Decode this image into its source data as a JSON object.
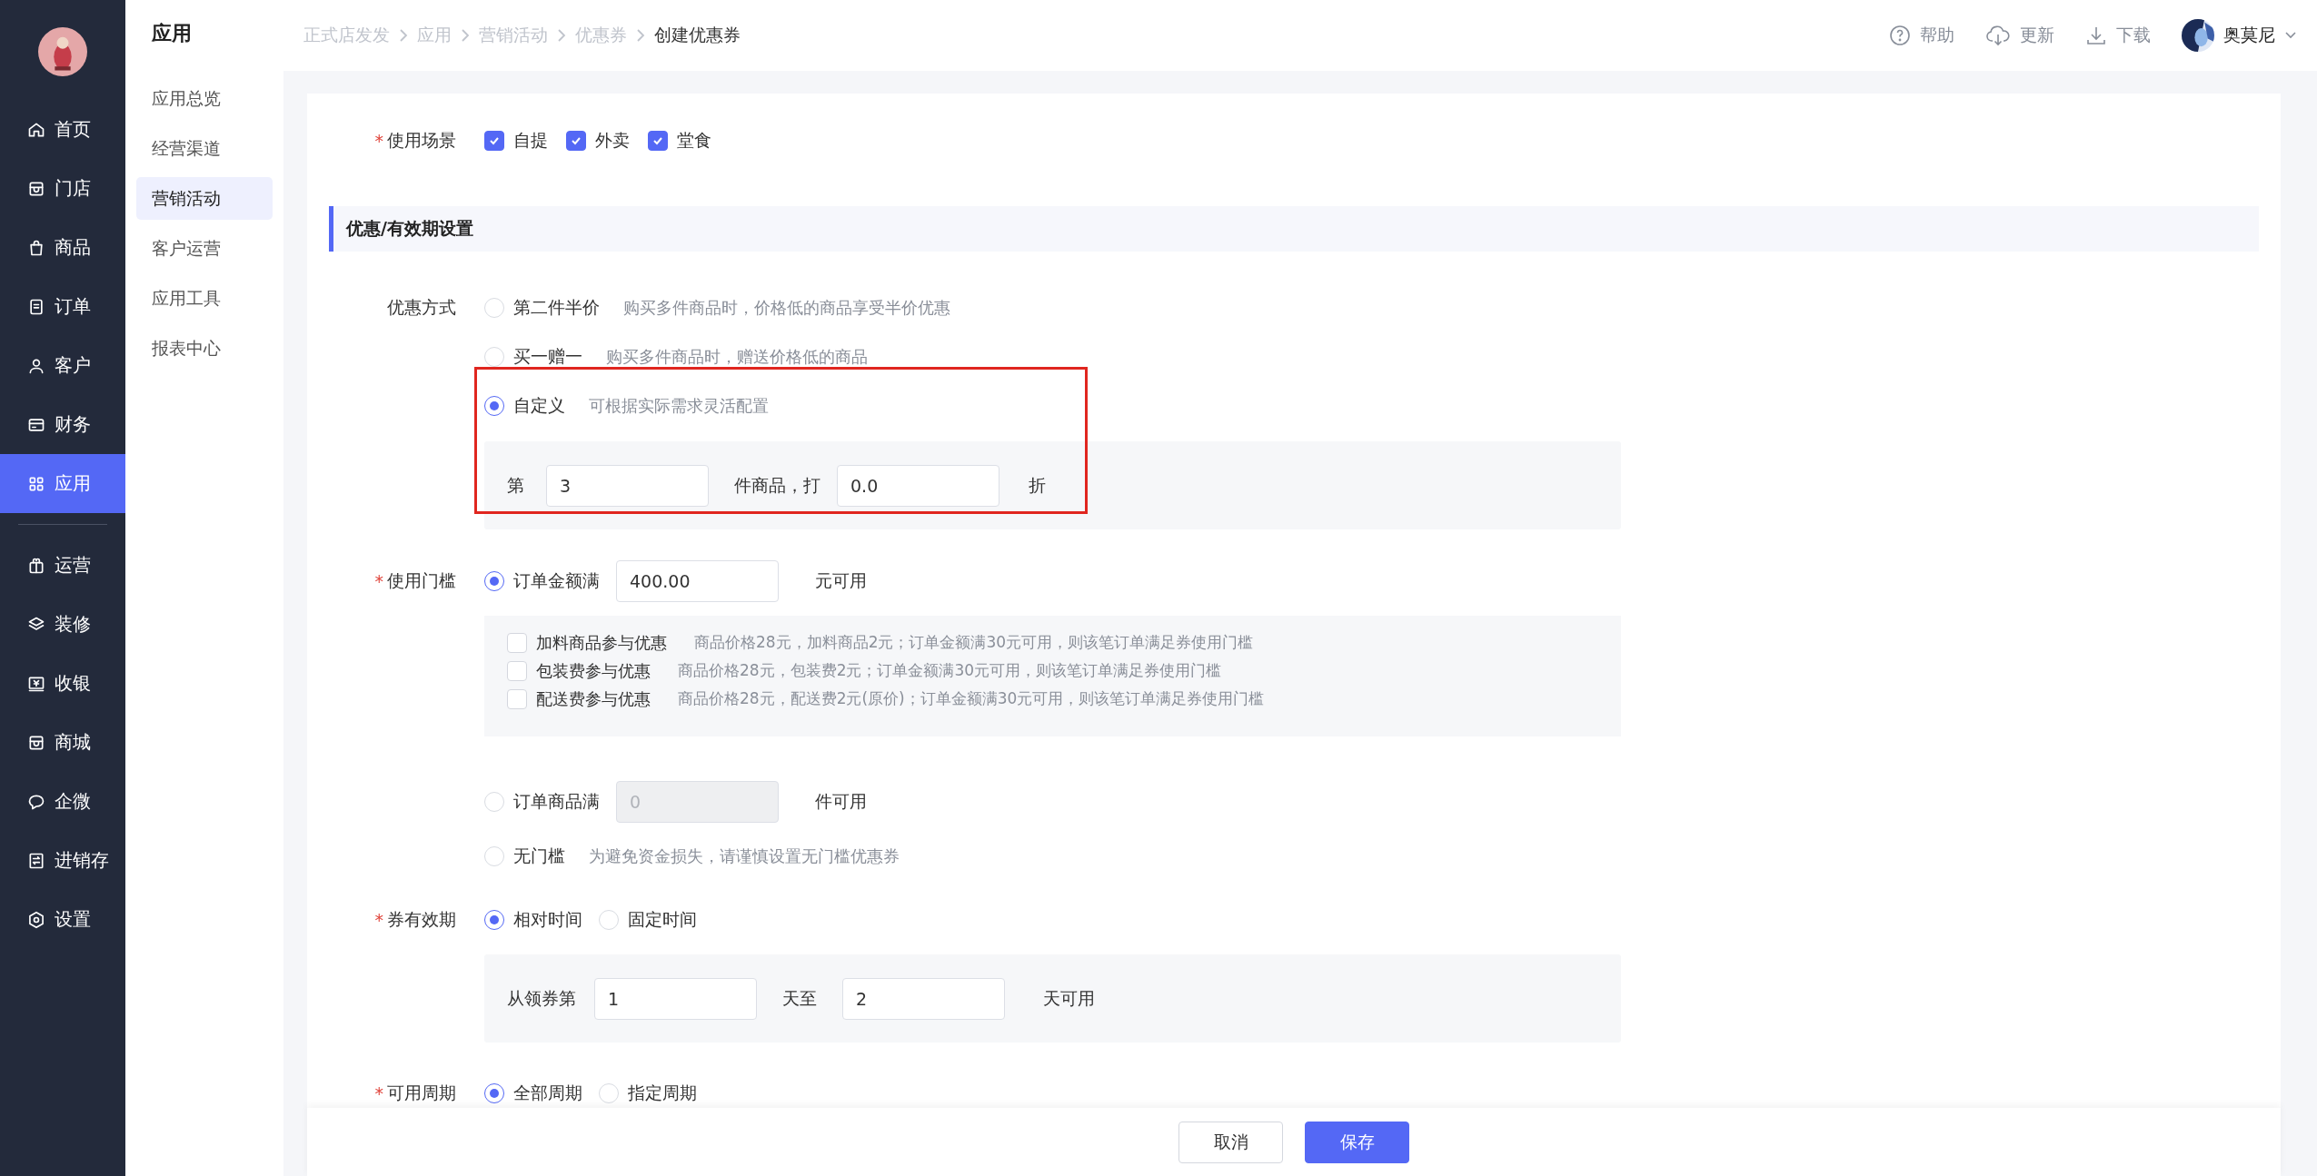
{
  "nav": {
    "primary": [
      {
        "label": "首页",
        "selected": false
      },
      {
        "label": "门店",
        "selected": false
      },
      {
        "label": "商品",
        "selected": false
      },
      {
        "label": "订单",
        "selected": false
      },
      {
        "label": "客户",
        "selected": false
      },
      {
        "label": "财务",
        "selected": false
      },
      {
        "label": "应用",
        "selected": true
      }
    ],
    "secondary": [
      {
        "label": "运营",
        "selected": false
      },
      {
        "label": "装修",
        "selected": false
      },
      {
        "label": "收银",
        "selected": false
      },
      {
        "label": "商城",
        "selected": false
      },
      {
        "label": "企微",
        "selected": false
      },
      {
        "label": "进销存",
        "selected": false
      },
      {
        "label": "设置",
        "selected": false
      }
    ]
  },
  "submenu": {
    "title": "应用",
    "items": [
      {
        "label": "应用总览",
        "selected": false
      },
      {
        "label": "经营渠道",
        "selected": false
      },
      {
        "label": "营销活动",
        "selected": true
      },
      {
        "label": "客户运营",
        "selected": false
      },
      {
        "label": "应用工具",
        "selected": false
      },
      {
        "label": "报表中心",
        "selected": false
      }
    ]
  },
  "breadcrumb": [
    {
      "label": "正式店发发",
      "current": false
    },
    {
      "label": "应用",
      "current": false
    },
    {
      "label": "营销活动",
      "current": false
    },
    {
      "label": "优惠券",
      "current": false
    },
    {
      "label": "创建优惠券",
      "current": true
    }
  ],
  "header_actions": [
    {
      "label": "帮助"
    },
    {
      "label": "更新"
    },
    {
      "label": "下载"
    }
  ],
  "user": {
    "name": "奥莫尼"
  },
  "form": {
    "scene": {
      "mark": "*",
      "label": "使用场景",
      "options": [
        {
          "label": "自提",
          "checked": true
        },
        {
          "label": "外卖",
          "checked": true
        },
        {
          "label": "堂食",
          "checked": true
        }
      ]
    },
    "section_title": "优惠/有效期设置",
    "discount": {
      "label": "优惠方式",
      "options": [
        {
          "label": "第二件半价",
          "hint": "购买多件商品时，价格低的商品享受半价优惠",
          "selected": false
        },
        {
          "label": "买一赠一",
          "hint": "购买多件商品时，赠送价格低的商品",
          "selected": false
        },
        {
          "label": "自定义",
          "hint": "可根据实际需求灵活配置",
          "selected": true
        }
      ],
      "highlighted": true,
      "rule": {
        "prefix": "第",
        "count": "3",
        "middle": "件商品，打",
        "rate": "0.0",
        "suffix": "折"
      }
    },
    "threshold": {
      "mark": "*",
      "label": "使用门槛",
      "amount": {
        "label": "订单金额满",
        "value": "400.00",
        "suffix": "元可用",
        "selected": true
      },
      "extras": [
        {
          "label": "加料商品参与优惠",
          "hint": "商品价格28元，加料商品2元；订单金额满30元可用，则该笔订单满足券使用门槛",
          "checked": false
        },
        {
          "label": "包装费参与优惠",
          "hint": "商品价格28元，包装费2元；订单金额满30元可用，则该笔订单满足券使用门槛",
          "checked": false
        },
        {
          "label": "配送费参与优惠",
          "hint": "商品价格28元，配送费2元(原价)；订单金额满30元可用，则该笔订单满足券使用门槛",
          "checked": false
        }
      ],
      "items": {
        "label": "订单商品满",
        "value": "0",
        "suffix": "件可用",
        "selected": false,
        "disabled": true
      },
      "none": {
        "label": "无门槛",
        "hint": "为避免资金损失，请谨慎设置无门槛优惠券",
        "selected": false
      }
    },
    "validity": {
      "mark": "*",
      "label": "券有效期",
      "options": [
        {
          "label": "相对时间",
          "selected": true
        },
        {
          "label": "固定时间",
          "selected": false
        }
      ],
      "range": {
        "prefix": "从领券第",
        "from": "1",
        "middle": "天至",
        "to": "2",
        "suffix": "天可用"
      }
    },
    "period": {
      "mark": "*",
      "label": "可用周期",
      "options": [
        {
          "label": "全部周期",
          "selected": true
        },
        {
          "label": "指定周期",
          "selected": false
        }
      ]
    }
  },
  "footer": {
    "buttons": [
      {
        "label": "取消",
        "kind": "secondary"
      },
      {
        "label": "保存",
        "kind": "primary"
      }
    ]
  }
}
